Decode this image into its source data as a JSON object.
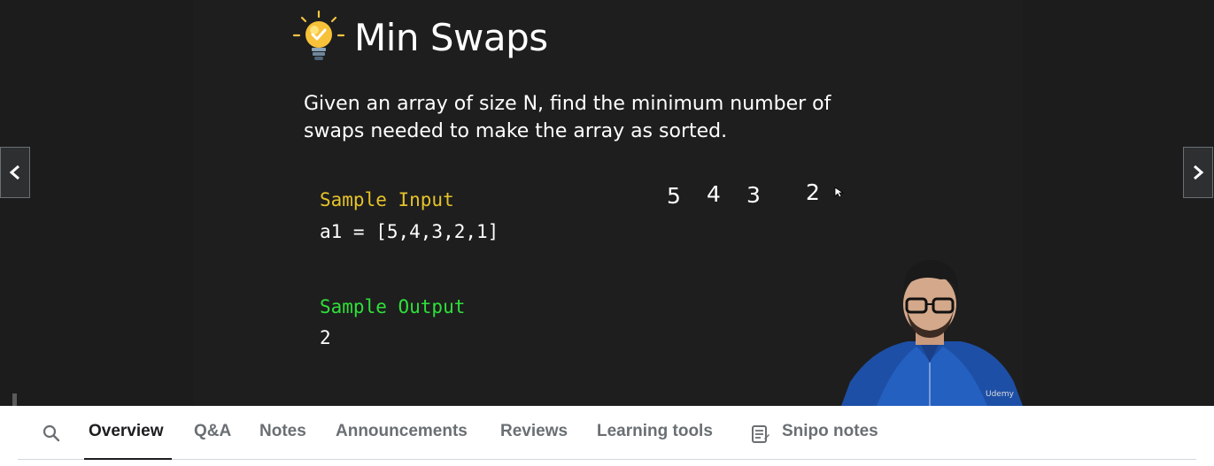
{
  "slide": {
    "title": "Min Swaps",
    "description": "Given an array of size N, find the minimum number of swaps needed to make the array as sorted.",
    "sample_input_label": "Sample Input",
    "sample_input_value": "a1 = [5,4,3,2,1]",
    "sample_output_label": "Sample Output",
    "sample_output_value": "2",
    "handwriting": [
      "5",
      "4",
      "3",
      "2"
    ],
    "icon": "lightbulb-icon",
    "colors": {
      "input_label": "#e6c32a",
      "output_label": "#2fe03a",
      "background": "#1e1e1e"
    }
  },
  "watermark": "Udemy",
  "navigation": {
    "prev_icon": "chevron-left-icon",
    "next_icon": "chevron-right-icon"
  },
  "tabs": {
    "search_icon": "search-icon",
    "items": [
      "Overview",
      "Q&A",
      "Notes",
      "Announcements",
      "Reviews",
      "Learning tools",
      "Snipo notes"
    ],
    "active": "Overview"
  }
}
